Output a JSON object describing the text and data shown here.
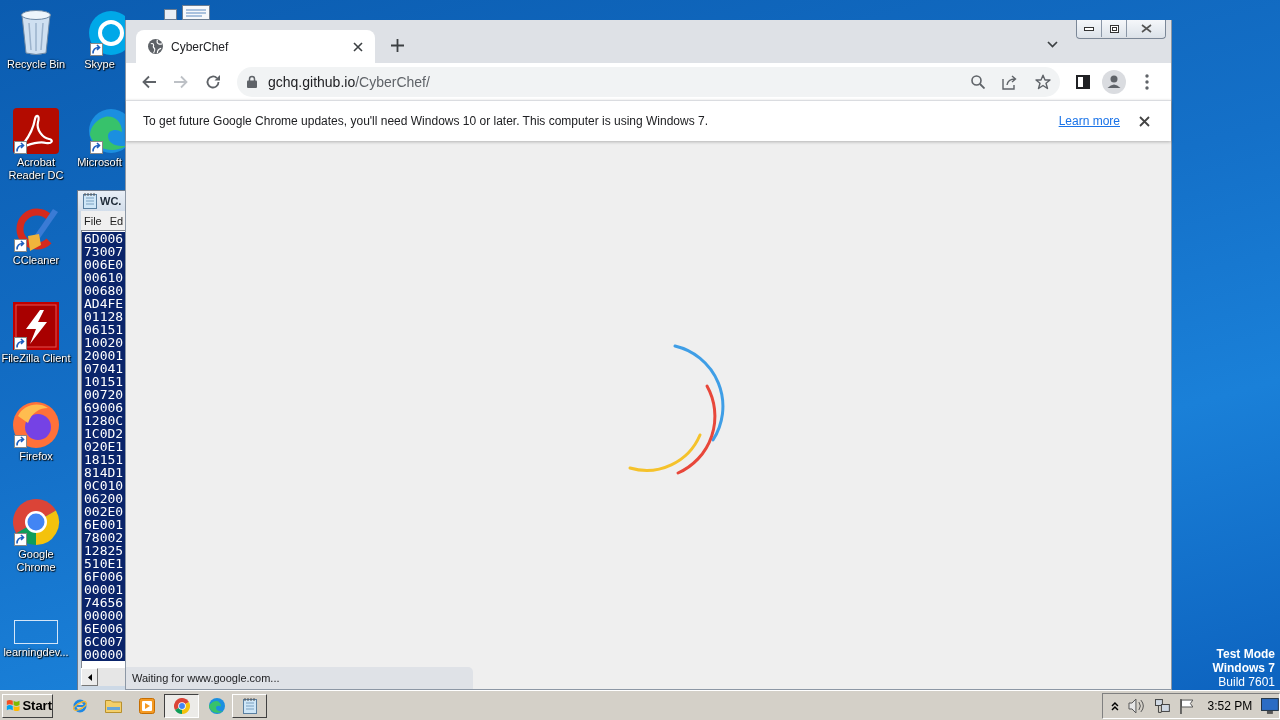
{
  "desktop": {
    "icon_columns": [
      [
        {
          "label": "Recycle Bin",
          "shortcut": false
        },
        {
          "label": "Acrobat Reader DC",
          "shortcut": true
        },
        {
          "label": "CCleaner",
          "shortcut": true
        },
        {
          "label": "FileZilla Client",
          "shortcut": true
        },
        {
          "label": "Firefox",
          "shortcut": true
        },
        {
          "label": "Google Chrome",
          "shortcut": true
        },
        {
          "label": "learningdev...",
          "shortcut": false
        }
      ],
      [
        {
          "label": "Skype",
          "shortcut": true
        },
        {
          "label": "Microsoft",
          "shortcut": true
        }
      ]
    ],
    "notice": {
      "mode": "Test Mode",
      "os": "Windows 7",
      "build": "Build 7601"
    }
  },
  "notepad": {
    "title": "WC.",
    "menu": [
      "File",
      "Ed"
    ],
    "selected": true,
    "lines": [
      "6D006",
      "73007",
      "006E0",
      "00610",
      "00680",
      "AD4FE",
      "01128",
      "06151",
      "10020",
      "20001",
      "07041",
      "10151",
      "00720",
      "69006",
      "1280C",
      "1C0D2",
      "020E1",
      "18151",
      "814D1",
      "0C010",
      "06200",
      "002E0",
      "6E001",
      "78002",
      "12825",
      "510E1",
      "6F006",
      "00001",
      "74656",
      "00000",
      "6E006",
      "6C007",
      "00000"
    ]
  },
  "browser": {
    "tabs": [
      {
        "title": "CyberChef",
        "selected": true
      }
    ],
    "toolbar": {
      "forward_disabled": true
    },
    "address": {
      "host": "gchq.github.io",
      "path": "/CyberChef/"
    },
    "infobar": {
      "message": "To get future Google Chrome updates, you'll need Windows 10 or later. This computer is using Windows 7.",
      "link": "Learn more"
    },
    "status": "Waiting for www.google.com..."
  },
  "taskbar": {
    "start": "Start",
    "window_buttons": [
      {
        "selected": true
      },
      {
        "selected": false
      }
    ],
    "clock": "3:52 PM"
  }
}
